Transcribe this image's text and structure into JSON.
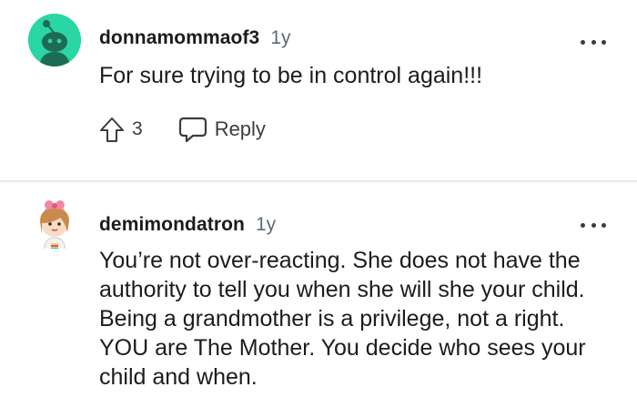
{
  "comments": [
    {
      "username": "donnamommaof3",
      "age": "1y",
      "body": "For sure trying to be in control again!!!",
      "upvotes": "3",
      "reply_label": "Reply",
      "avatar_color": "#29d6a4"
    },
    {
      "username": "demimondatron",
      "age": "1y",
      "body": "You’re not over-reacting. She does not have the authority to tell you when she will she your child. Being a grandmother is a privilege, not a right. YOU are The Mother. You decide who sees your child and when."
    }
  ],
  "icons": {
    "more": "more-options-icon",
    "upvote": "upvote-arrow-icon",
    "reply": "comment-bubble-icon"
  }
}
